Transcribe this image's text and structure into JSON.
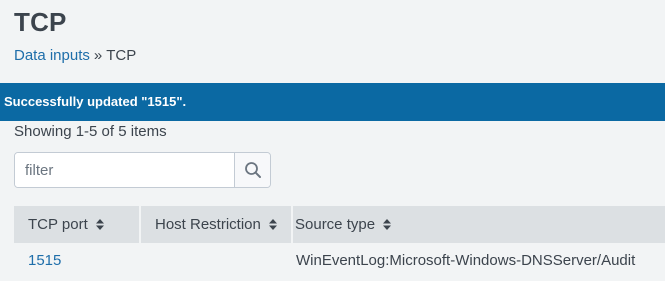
{
  "page": {
    "title": "TCP"
  },
  "breadcrumb": {
    "parent_label": "Data inputs",
    "separator": "»",
    "current_label": "TCP"
  },
  "banner": {
    "message": "Successfully updated \"1515\"."
  },
  "list": {
    "count_text": "Showing 1-5 of 5 items"
  },
  "filter": {
    "placeholder": "filter",
    "value": "",
    "icon": "search-icon"
  },
  "table": {
    "columns": [
      {
        "label": "TCP port",
        "sortable": true
      },
      {
        "label": "Host Restriction",
        "sortable": true
      },
      {
        "label": "Source type",
        "sortable": true
      }
    ],
    "rows": [
      {
        "tcp_port": "1515",
        "host_restriction": "",
        "source_type": "WinEventLog:Microsoft-Windows-DNSServer/Audit"
      }
    ]
  },
  "colors": {
    "banner_bg": "#0b69a3",
    "link": "#1e6eaa",
    "header_bg": "#dce0e3",
    "page_bg": "#f2f4f5"
  }
}
